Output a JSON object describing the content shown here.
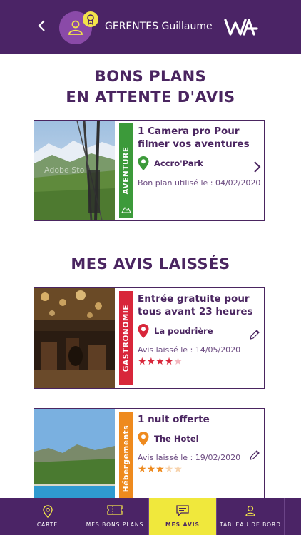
{
  "header": {
    "username": "GERENTES Guillaume",
    "back_icon": "chevron-left-icon",
    "logo_text": "WA"
  },
  "sections": {
    "pending_title_line1": "BONS PLANS",
    "pending_title_line2": "EN ATTENTE D'AVIS",
    "reviews_title": "MES AVIS LAISSÉS"
  },
  "pending": [
    {
      "category": "AVENTURE",
      "category_color": "#3c9a3a",
      "title": "1 Camera pro Pour filmer vos aventures",
      "place": "Accro'Park",
      "meta": "Bon plan utilisé le : 04/02/2020",
      "watermark": "Adobe Sto"
    }
  ],
  "reviews": [
    {
      "category": "GASTRONOMIE",
      "category_color": "#d8263a",
      "title": "Entrée gratuite pour tous avant 23 heures",
      "place": "La poudrière",
      "meta": "Avis laissé le : 14/05/2020",
      "rating": 4,
      "star_color": "#d8263a",
      "star_empty_color": "#f2b8c0"
    },
    {
      "category": "Hébergements",
      "category_color": "#ee8a1e",
      "title": "1 nuit offerte",
      "place": "The Hotel",
      "meta": "Avis laissé le : 19/02/2020",
      "rating": 3,
      "star_color": "#ee8a1e",
      "star_empty_color": "#f7d3ad"
    }
  ],
  "nav": {
    "items": [
      {
        "label": "CARTE",
        "icon": "map-pin-icon"
      },
      {
        "label": "MES BONS PLANS",
        "icon": "ticket-icon"
      },
      {
        "label": "MES AVIS",
        "icon": "chat-icon"
      },
      {
        "label": "TABLEAU DE BORD",
        "icon": "user-icon"
      }
    ],
    "active": "MES AVIS"
  }
}
